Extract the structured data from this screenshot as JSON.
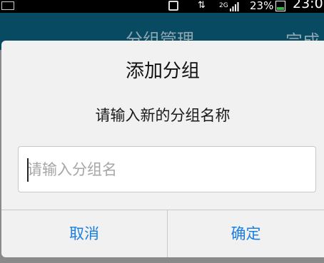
{
  "status_bar": {
    "network_type": "2G",
    "battery_percent": "23%",
    "time": "23:0"
  },
  "background_app": {
    "title": "分组管理",
    "done_label": "完成"
  },
  "dialog": {
    "title": "添加分组",
    "message": "请输入新的分组名称",
    "input_value": "",
    "input_placeholder": "请输入分组名",
    "cancel_label": "取消",
    "confirm_label": "确定"
  },
  "colors": {
    "button_text": "#1a7fe0",
    "header_bg": "#094a63"
  }
}
